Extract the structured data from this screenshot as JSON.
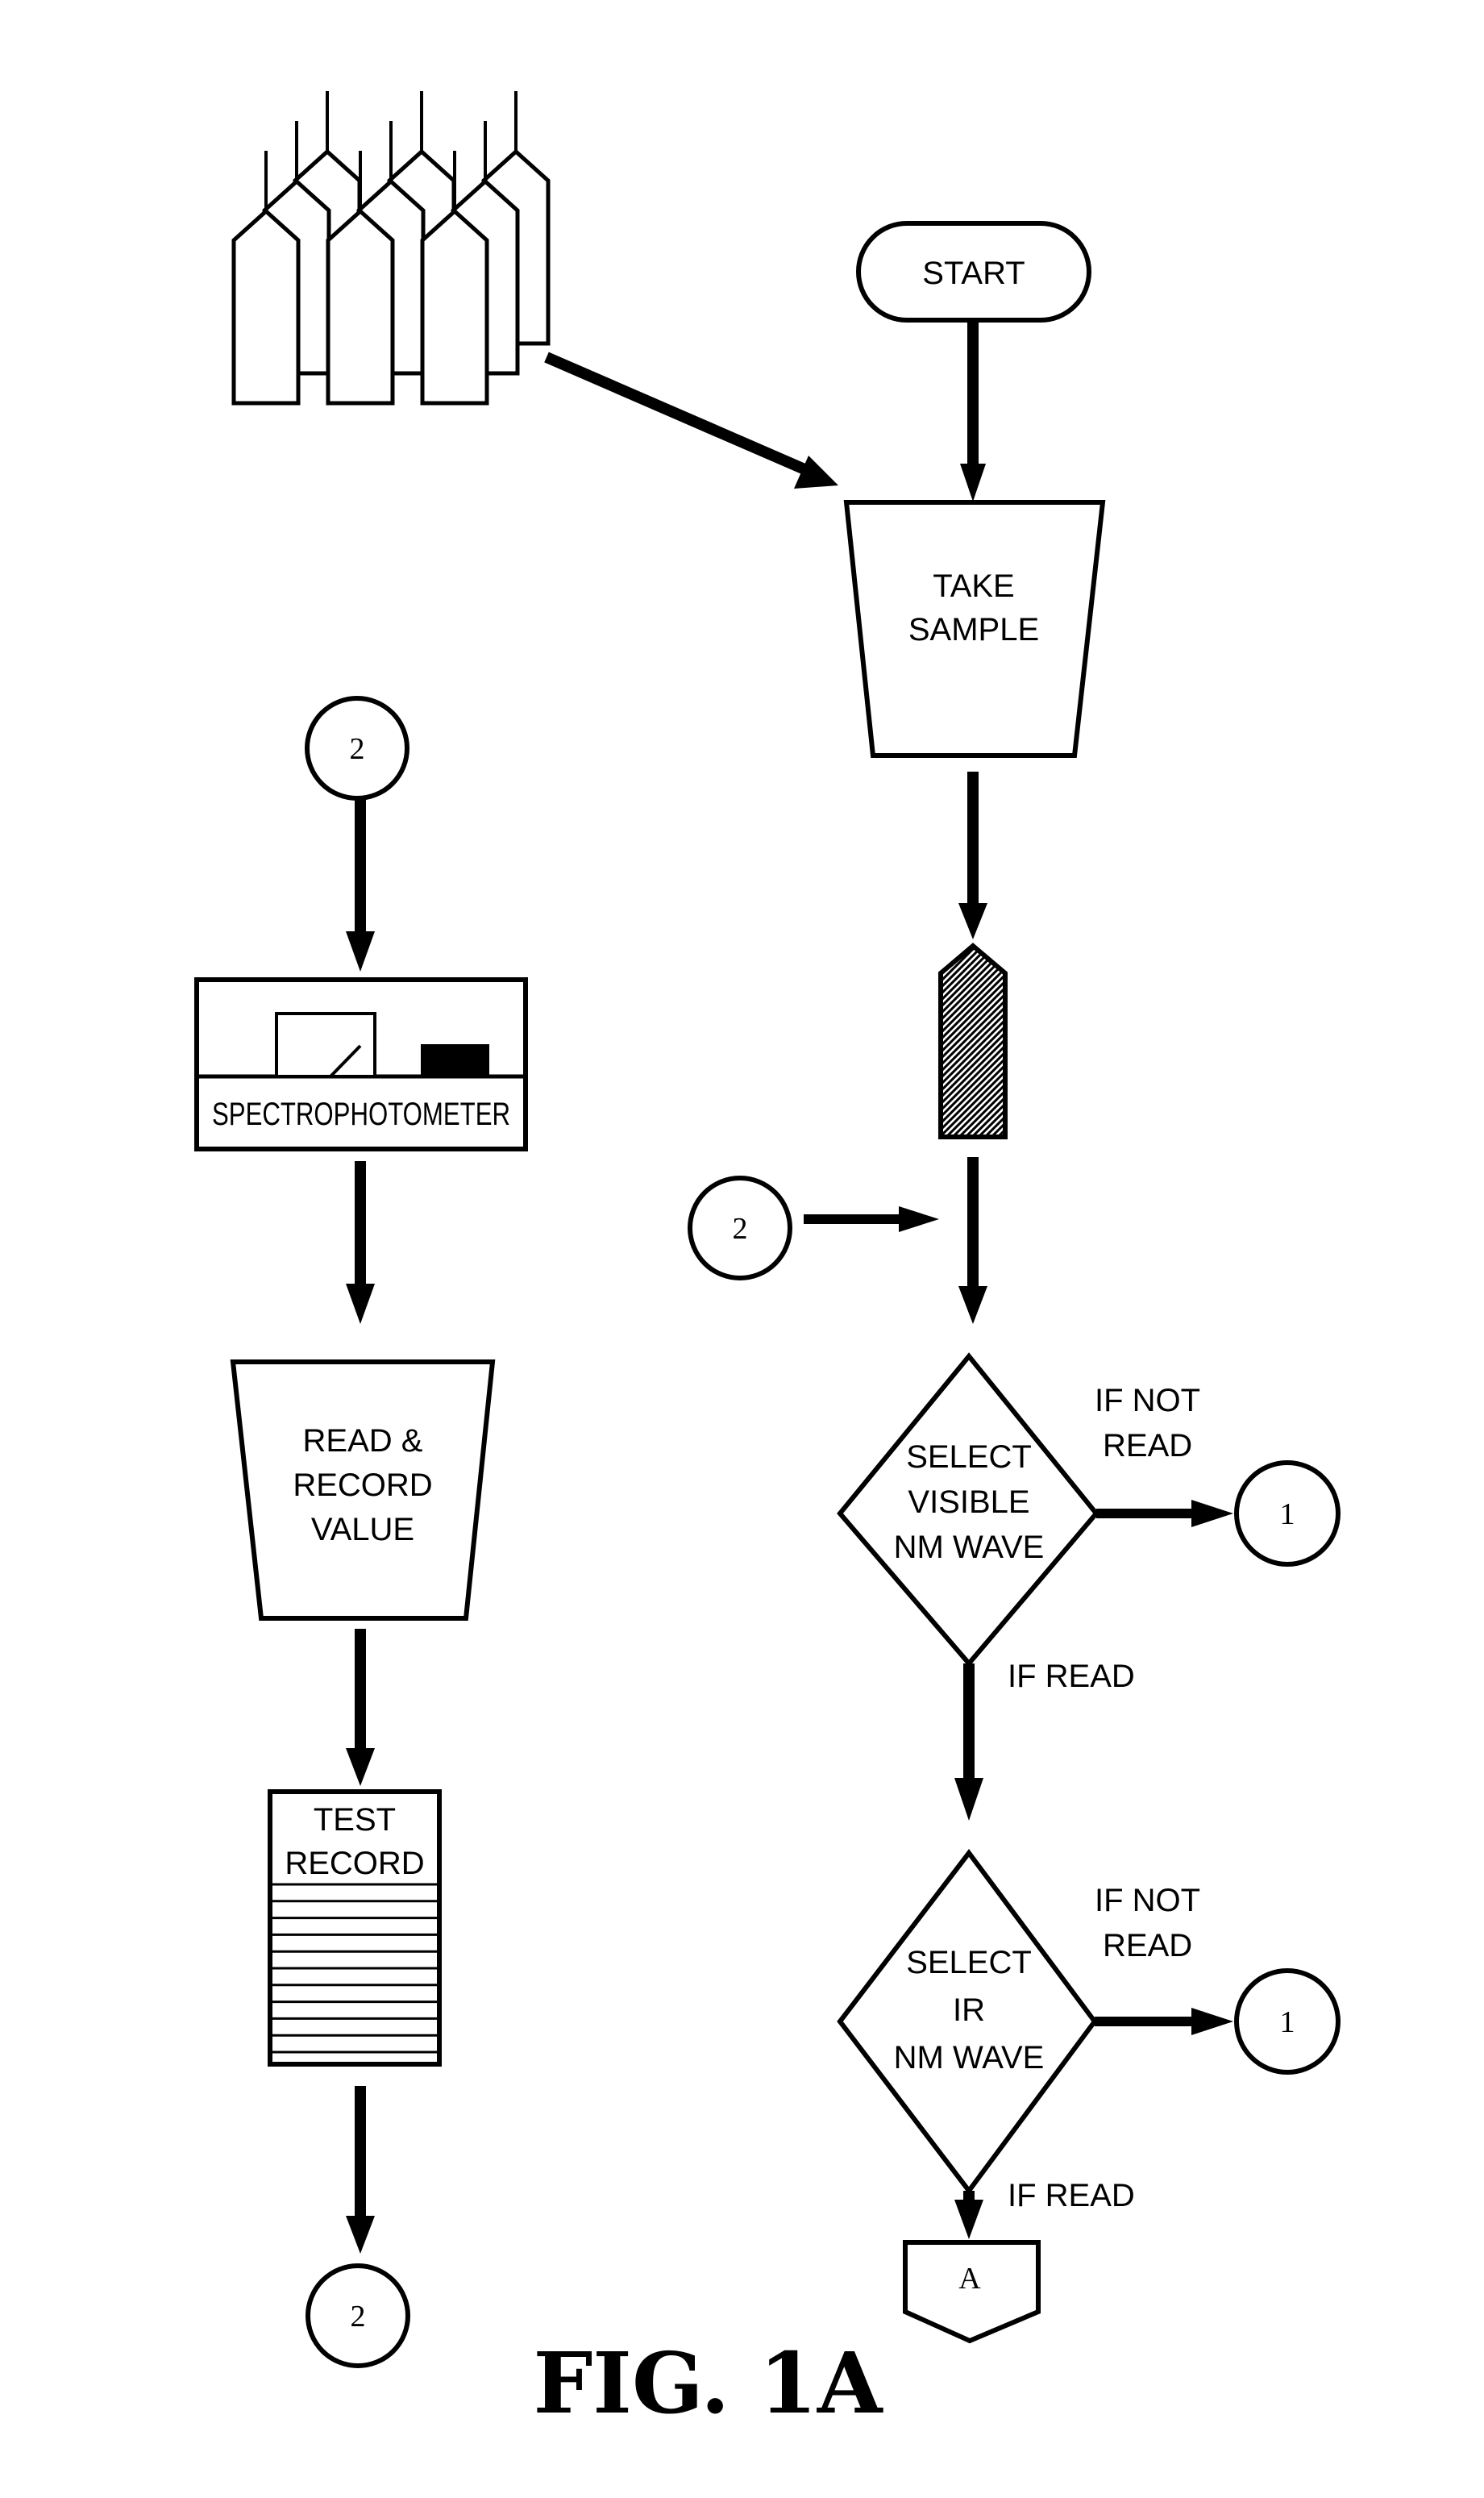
{
  "figure": {
    "title": "FIG. 1A",
    "accent_color": "#000000",
    "background_color": "#ffffff",
    "sample_fill_color": "#555555"
  },
  "nodes": {
    "start": {
      "type": "terminator",
      "label": "START"
    },
    "take_sample": {
      "type": "manual-operation",
      "lines": [
        "TAKE",
        "SAMPLE"
      ]
    },
    "sample_vial": {
      "type": "icon",
      "icon": "filled-sample-vial-icon"
    },
    "vial_rack": {
      "type": "icon",
      "icon": "sample-vials-icon",
      "count": 9
    },
    "connector_2_right": {
      "type": "connector",
      "label": "2"
    },
    "decision_visible": {
      "type": "decision",
      "lines": [
        "SELECT",
        "VISIBLE",
        "NM WAVE"
      ]
    },
    "connector_1_visible": {
      "type": "connector",
      "label": "1"
    },
    "decision_ir": {
      "type": "decision",
      "lines": [
        "SELECT",
        "IR",
        "NM WAVE"
      ]
    },
    "connector_1_ir": {
      "type": "connector",
      "label": "1"
    },
    "offpage_a": {
      "type": "off-page-connector",
      "label": "A"
    },
    "connector_2_top_left": {
      "type": "connector",
      "label": "2"
    },
    "spectrophotometer": {
      "type": "device",
      "label": "SPECTROPHOTOMETER"
    },
    "read_record": {
      "type": "manual-operation",
      "lines": [
        "READ &",
        "RECORD",
        "VALUE"
      ]
    },
    "test_record": {
      "type": "document",
      "lines": [
        "TEST",
        "RECORD"
      ],
      "ruled_lines": 11
    },
    "connector_2_bottom_left": {
      "type": "connector",
      "label": "2"
    }
  },
  "edges": {
    "visible_not_read": {
      "lines": [
        "IF NOT",
        "READ"
      ]
    },
    "visible_read": {
      "label": "IF READ"
    },
    "ir_not_read": {
      "lines": [
        "IF NOT",
        "READ"
      ]
    },
    "ir_read": {
      "label": "IF READ"
    }
  }
}
